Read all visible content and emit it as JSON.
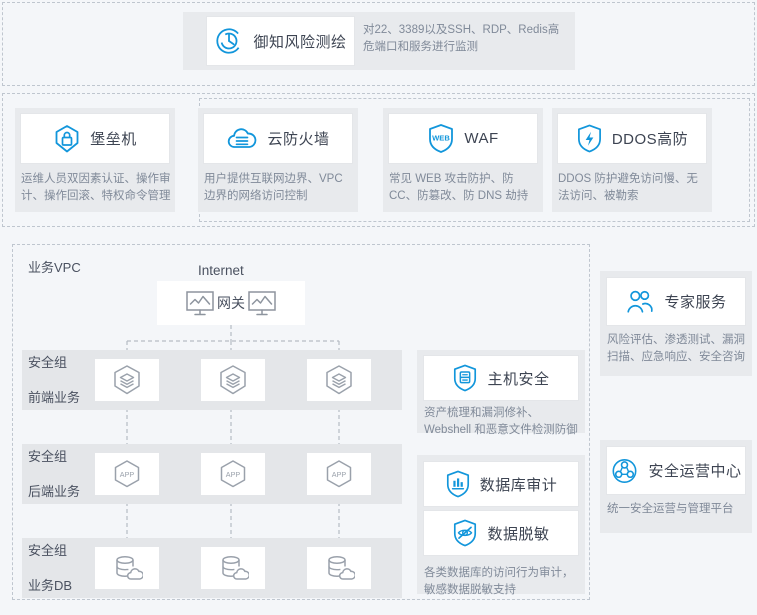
{
  "sections": {
    "risk_mapping": {
      "card": {
        "title": "御知风险测绘",
        "icon": "risk-radar-icon"
      },
      "description": "对22、3389以及SSH、RDP、Redis高危端口和服务进行监测"
    },
    "protection": {
      "items": [
        {
          "title": "堡垒机",
          "icon": "lock-shield-icon",
          "description": "运维人员双因素认证、操作审计、操作回滚、特权命令管理"
        },
        {
          "title": "云防火墙",
          "icon": "cloud-firewall-icon",
          "description": "用户提供互联网边界、VPC边界的网络访问控制"
        },
        {
          "title": "WAF",
          "icon": "web-shield-icon",
          "description": "常见 WEB 攻击防护、防CC、防篡改、防 DNS 劫持"
        },
        {
          "title": "DDOS高防",
          "icon": "bolt-shield-icon",
          "description": "DDOS 防护避免访问慢、无法访问、被勒索"
        }
      ]
    },
    "vpc": {
      "label": "业务VPC",
      "internet_label": "Internet",
      "gateway_label": "网关",
      "gateway_icon": "monitor-icon",
      "tiers": [
        {
          "group_label": "安全组",
          "tier_label": "前端业务",
          "node_icon": "layers-hexagon-icon",
          "node_count": 3
        },
        {
          "group_label": "安全组",
          "tier_label": "后端业务",
          "node_icon": "app-hexagon-icon",
          "node_count": 3
        },
        {
          "group_label": "安全组",
          "tier_label": "业务DB",
          "node_icon": "database-cloud-icon",
          "node_count": 3
        }
      ]
    },
    "host_security": {
      "card": {
        "title": "主机安全",
        "icon": "host-shield-icon"
      },
      "description": "资产梳理和漏洞修补、Webshell 和恶意文件检测防御"
    },
    "data_security": {
      "cards": [
        {
          "title": "数据库审计",
          "icon": "chart-shield-icon"
        },
        {
          "title": "数据脱敏",
          "icon": "eye-off-shield-icon"
        }
      ],
      "description": "各类数据库的访问行为审计，敏感数据脱敏支持"
    },
    "expert_service": {
      "card": {
        "title": "专家服务",
        "icon": "people-icon"
      },
      "description": "风险评估、渗透测试、漏洞扫描、应急响应、安全咨询"
    },
    "soc": {
      "card": {
        "title": "安全运营中心",
        "icon": "network-nodes-icon"
      },
      "description": "统一安全运营与管理平台"
    }
  },
  "colors": {
    "accent": "#1296db",
    "page_bg": "#f4f6f9",
    "tile_bg": "#e8eaed",
    "band_bg": "#e4e6e9",
    "card_bg": "#ffffff",
    "text_dark": "#3d4452",
    "text_muted": "#808a99",
    "dash_border": "#bfc6cf",
    "node_stroke": "#9aa1ab"
  }
}
